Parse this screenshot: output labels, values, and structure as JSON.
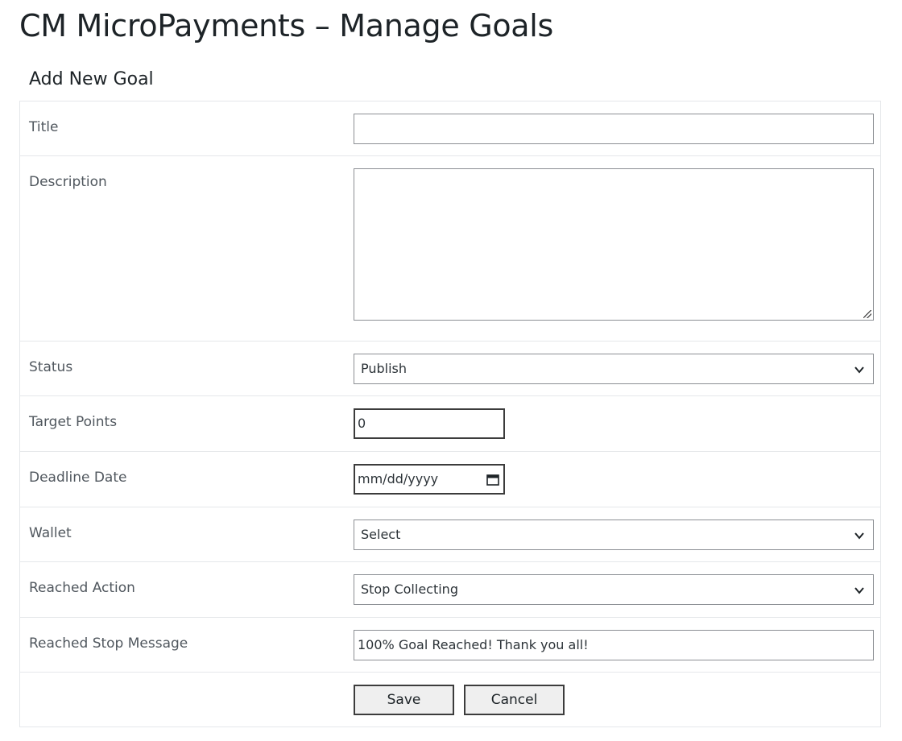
{
  "page": {
    "title": "CM MicroPayments – Manage Goals",
    "section_title": "Add New Goal"
  },
  "form": {
    "title": {
      "label": "Title",
      "value": ""
    },
    "description": {
      "label": "Description",
      "value": ""
    },
    "status": {
      "label": "Status",
      "selected": "Publish"
    },
    "target_points": {
      "label": "Target Points",
      "value": "0"
    },
    "deadline_date": {
      "label": "Deadline Date",
      "placeholder": "mm/dd/yyyy"
    },
    "wallet": {
      "label": "Wallet",
      "selected": "Select"
    },
    "reached_action": {
      "label": "Reached Action",
      "selected": "Stop Collecting"
    },
    "reached_stop_message": {
      "label": "Reached Stop Message",
      "value": "100% Goal Reached! Thank you all!"
    }
  },
  "buttons": {
    "save": "Save",
    "cancel": "Cancel"
  },
  "icons": {
    "select_arrow": "chevron-down-icon",
    "date_picker": "calendar-icon",
    "textarea_resize": "resize-grip-icon"
  }
}
